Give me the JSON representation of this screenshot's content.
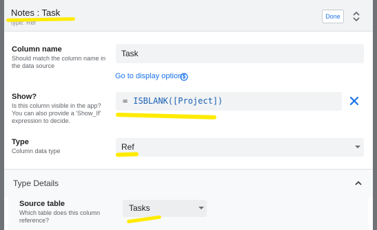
{
  "header": {
    "title": "Notes : Task",
    "subtitle": "type: Ref",
    "done_label": "Done",
    "expand_icon": "unfold-more-icon"
  },
  "column_name": {
    "title": "Column name",
    "description": "Should match the column name in the data source",
    "value": "Task",
    "display_link": "Go to display options",
    "info_icon": "info-icon"
  },
  "show": {
    "title": "Show?",
    "description": "Is this column visible in the app? You can also provide a 'Show_If' expression to decide.",
    "equals": "=",
    "expression": "ISBLANK([Project])",
    "clear_icon": "close-icon"
  },
  "type": {
    "title": "Type",
    "description": "Column data type",
    "value": "Ref"
  },
  "type_details": {
    "title": "Type Details",
    "source_table": {
      "title": "Source table",
      "description": "Which table does this column reference?",
      "value": "Tasks"
    }
  },
  "colors": {
    "accent": "#1a73e8",
    "highlight": "#ffeb00",
    "field_bg": "#f1f3f4"
  }
}
